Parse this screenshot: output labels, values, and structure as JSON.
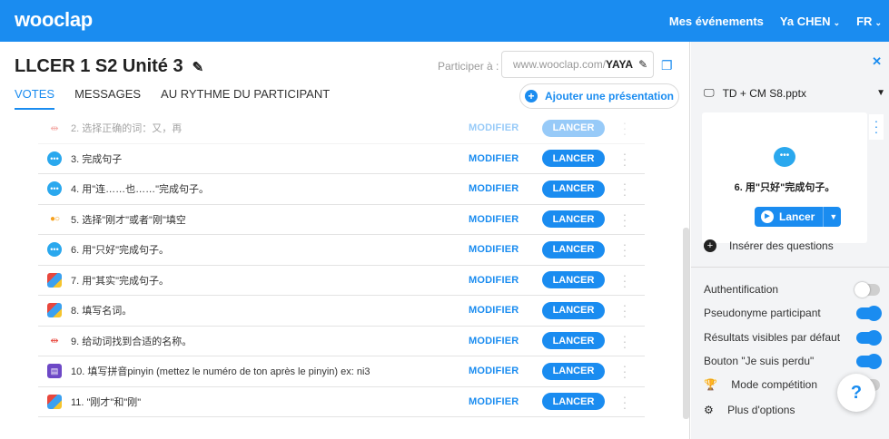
{
  "topbar": {
    "logo": "wooclap",
    "events_label": "Mes événements",
    "user_name": "Ya CHEN",
    "language": "FR",
    "chevron": "⌄"
  },
  "event": {
    "title": "LLCER 1 S2 Unité 3",
    "participate_label": "Participer à :",
    "url_prefix": "www.wooclap.com/",
    "url_code": "YAYA"
  },
  "tabs": [
    "VOTES",
    "MESSAGES",
    "AU RYTHME DU PARTICIPANT"
  ],
  "add_presentation_label": "Ajouter une présentation",
  "row_actions": {
    "modify": "MODIFIER",
    "launch": "LANCER"
  },
  "questions": [
    {
      "label": "2. 选择正确的词：又，再",
      "icon": "match-icon"
    },
    {
      "label": "3. 完成句子",
      "icon": "chat-icon"
    },
    {
      "label": "4. 用\"连……也……\"完成句子。",
      "icon": "chat-icon"
    },
    {
      "label": "5. 选择\"刚才\"或者\"刚\"填空",
      "icon": "dots-icon"
    },
    {
      "label": "6. 用\"只好\"完成句子。",
      "icon": "chat-icon"
    },
    {
      "label": "7. 用\"其实\"完成句子。",
      "icon": "cube-icon"
    },
    {
      "label": "8. 填写名词。",
      "icon": "cube-icon"
    },
    {
      "label": "9. 给动词找到合适的名称。",
      "icon": "match-icon"
    },
    {
      "label": "10. 填写拼音pinyin (mettez le numéro de ton après le pinyin) ex: ni3",
      "icon": "purple-icon"
    },
    {
      "label": "11. \"刚才\"和\"刚\"",
      "icon": "cube-icon"
    }
  ],
  "sidebar": {
    "presentation_file": "TD + CM S8.pptx",
    "preview_question": "6. 用\"只好\"完成句子。",
    "launch_label": "Lancer",
    "insert_label": "Insérer des questions",
    "settings": [
      {
        "label": "Authentification",
        "on": false
      },
      {
        "label": "Pseudonyme participant",
        "on": true
      },
      {
        "label": "Résultats visibles par défaut",
        "on": true
      },
      {
        "label": "Bouton \"Je suis perdu\"",
        "on": true
      },
      {
        "label": "Mode compétition",
        "on": false
      },
      {
        "label": "Plus d'options",
        "on": null
      }
    ],
    "help_label": "?"
  },
  "colors": {
    "brand_blue": "#1a8cf0",
    "chat_blue": "#2aa8ee",
    "poll_orange": "#f6a11e",
    "match_red": "#e8473d",
    "purple": "#6d48c6"
  }
}
